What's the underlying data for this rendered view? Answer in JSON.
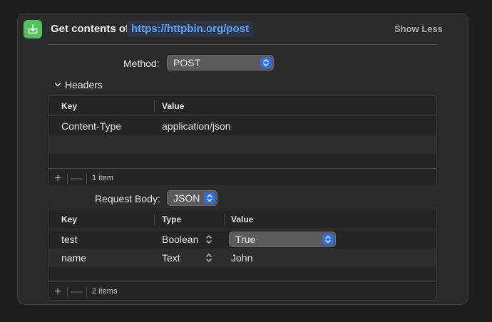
{
  "action": {
    "title": "Get contents of",
    "url": "https://httpbin.org/post",
    "show_less": "Show Less",
    "icon": "download-icon"
  },
  "method": {
    "label": "Method:",
    "value": "POST"
  },
  "headers": {
    "disclosure_label": "Headers",
    "columns": [
      "Key",
      "Value"
    ],
    "rows": [
      {
        "key": "Content-Type",
        "value": "application/json"
      }
    ],
    "count": "1 item"
  },
  "request_body": {
    "label": "Request Body:",
    "value": "JSON"
  },
  "body": {
    "columns": [
      "Key",
      "Type",
      "Value"
    ],
    "rows": [
      {
        "key": "test",
        "type": "Boolean",
        "value": "True"
      },
      {
        "key": "name",
        "type": "Text",
        "value": "John"
      }
    ],
    "count": "2 items"
  },
  "footer": {
    "add": "+",
    "remove": "—"
  },
  "colors": {
    "accent": "#2f6fe0",
    "icon_bg": "#53c25b",
    "url": "#5aa3ff"
  }
}
